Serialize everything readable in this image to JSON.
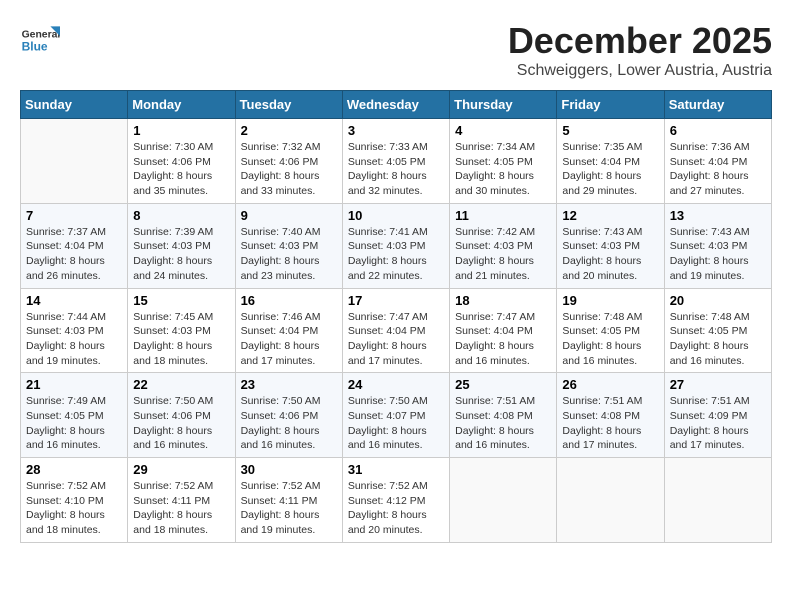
{
  "logo": {
    "general": "General",
    "blue": "Blue"
  },
  "title": "December 2025",
  "subtitle": "Schweiggers, Lower Austria, Austria",
  "days_of_week": [
    "Sunday",
    "Monday",
    "Tuesday",
    "Wednesday",
    "Thursday",
    "Friday",
    "Saturday"
  ],
  "weeks": [
    [
      {
        "num": "",
        "info": ""
      },
      {
        "num": "1",
        "info": "Sunrise: 7:30 AM\nSunset: 4:06 PM\nDaylight: 8 hours\nand 35 minutes."
      },
      {
        "num": "2",
        "info": "Sunrise: 7:32 AM\nSunset: 4:06 PM\nDaylight: 8 hours\nand 33 minutes."
      },
      {
        "num": "3",
        "info": "Sunrise: 7:33 AM\nSunset: 4:05 PM\nDaylight: 8 hours\nand 32 minutes."
      },
      {
        "num": "4",
        "info": "Sunrise: 7:34 AM\nSunset: 4:05 PM\nDaylight: 8 hours\nand 30 minutes."
      },
      {
        "num": "5",
        "info": "Sunrise: 7:35 AM\nSunset: 4:04 PM\nDaylight: 8 hours\nand 29 minutes."
      },
      {
        "num": "6",
        "info": "Sunrise: 7:36 AM\nSunset: 4:04 PM\nDaylight: 8 hours\nand 27 minutes."
      }
    ],
    [
      {
        "num": "7",
        "info": "Sunrise: 7:37 AM\nSunset: 4:04 PM\nDaylight: 8 hours\nand 26 minutes."
      },
      {
        "num": "8",
        "info": "Sunrise: 7:39 AM\nSunset: 4:03 PM\nDaylight: 8 hours\nand 24 minutes."
      },
      {
        "num": "9",
        "info": "Sunrise: 7:40 AM\nSunset: 4:03 PM\nDaylight: 8 hours\nand 23 minutes."
      },
      {
        "num": "10",
        "info": "Sunrise: 7:41 AM\nSunset: 4:03 PM\nDaylight: 8 hours\nand 22 minutes."
      },
      {
        "num": "11",
        "info": "Sunrise: 7:42 AM\nSunset: 4:03 PM\nDaylight: 8 hours\nand 21 minutes."
      },
      {
        "num": "12",
        "info": "Sunrise: 7:43 AM\nSunset: 4:03 PM\nDaylight: 8 hours\nand 20 minutes."
      },
      {
        "num": "13",
        "info": "Sunrise: 7:43 AM\nSunset: 4:03 PM\nDaylight: 8 hours\nand 19 minutes."
      }
    ],
    [
      {
        "num": "14",
        "info": "Sunrise: 7:44 AM\nSunset: 4:03 PM\nDaylight: 8 hours\nand 19 minutes."
      },
      {
        "num": "15",
        "info": "Sunrise: 7:45 AM\nSunset: 4:03 PM\nDaylight: 8 hours\nand 18 minutes."
      },
      {
        "num": "16",
        "info": "Sunrise: 7:46 AM\nSunset: 4:04 PM\nDaylight: 8 hours\nand 17 minutes."
      },
      {
        "num": "17",
        "info": "Sunrise: 7:47 AM\nSunset: 4:04 PM\nDaylight: 8 hours\nand 17 minutes."
      },
      {
        "num": "18",
        "info": "Sunrise: 7:47 AM\nSunset: 4:04 PM\nDaylight: 8 hours\nand 16 minutes."
      },
      {
        "num": "19",
        "info": "Sunrise: 7:48 AM\nSunset: 4:05 PM\nDaylight: 8 hours\nand 16 minutes."
      },
      {
        "num": "20",
        "info": "Sunrise: 7:48 AM\nSunset: 4:05 PM\nDaylight: 8 hours\nand 16 minutes."
      }
    ],
    [
      {
        "num": "21",
        "info": "Sunrise: 7:49 AM\nSunset: 4:05 PM\nDaylight: 8 hours\nand 16 minutes."
      },
      {
        "num": "22",
        "info": "Sunrise: 7:50 AM\nSunset: 4:06 PM\nDaylight: 8 hours\nand 16 minutes."
      },
      {
        "num": "23",
        "info": "Sunrise: 7:50 AM\nSunset: 4:06 PM\nDaylight: 8 hours\nand 16 minutes."
      },
      {
        "num": "24",
        "info": "Sunrise: 7:50 AM\nSunset: 4:07 PM\nDaylight: 8 hours\nand 16 minutes."
      },
      {
        "num": "25",
        "info": "Sunrise: 7:51 AM\nSunset: 4:08 PM\nDaylight: 8 hours\nand 16 minutes."
      },
      {
        "num": "26",
        "info": "Sunrise: 7:51 AM\nSunset: 4:08 PM\nDaylight: 8 hours\nand 17 minutes."
      },
      {
        "num": "27",
        "info": "Sunrise: 7:51 AM\nSunset: 4:09 PM\nDaylight: 8 hours\nand 17 minutes."
      }
    ],
    [
      {
        "num": "28",
        "info": "Sunrise: 7:52 AM\nSunset: 4:10 PM\nDaylight: 8 hours\nand 18 minutes."
      },
      {
        "num": "29",
        "info": "Sunrise: 7:52 AM\nSunset: 4:11 PM\nDaylight: 8 hours\nand 18 minutes."
      },
      {
        "num": "30",
        "info": "Sunrise: 7:52 AM\nSunset: 4:11 PM\nDaylight: 8 hours\nand 19 minutes."
      },
      {
        "num": "31",
        "info": "Sunrise: 7:52 AM\nSunset: 4:12 PM\nDaylight: 8 hours\nand 20 minutes."
      },
      {
        "num": "",
        "info": ""
      },
      {
        "num": "",
        "info": ""
      },
      {
        "num": "",
        "info": ""
      }
    ]
  ]
}
